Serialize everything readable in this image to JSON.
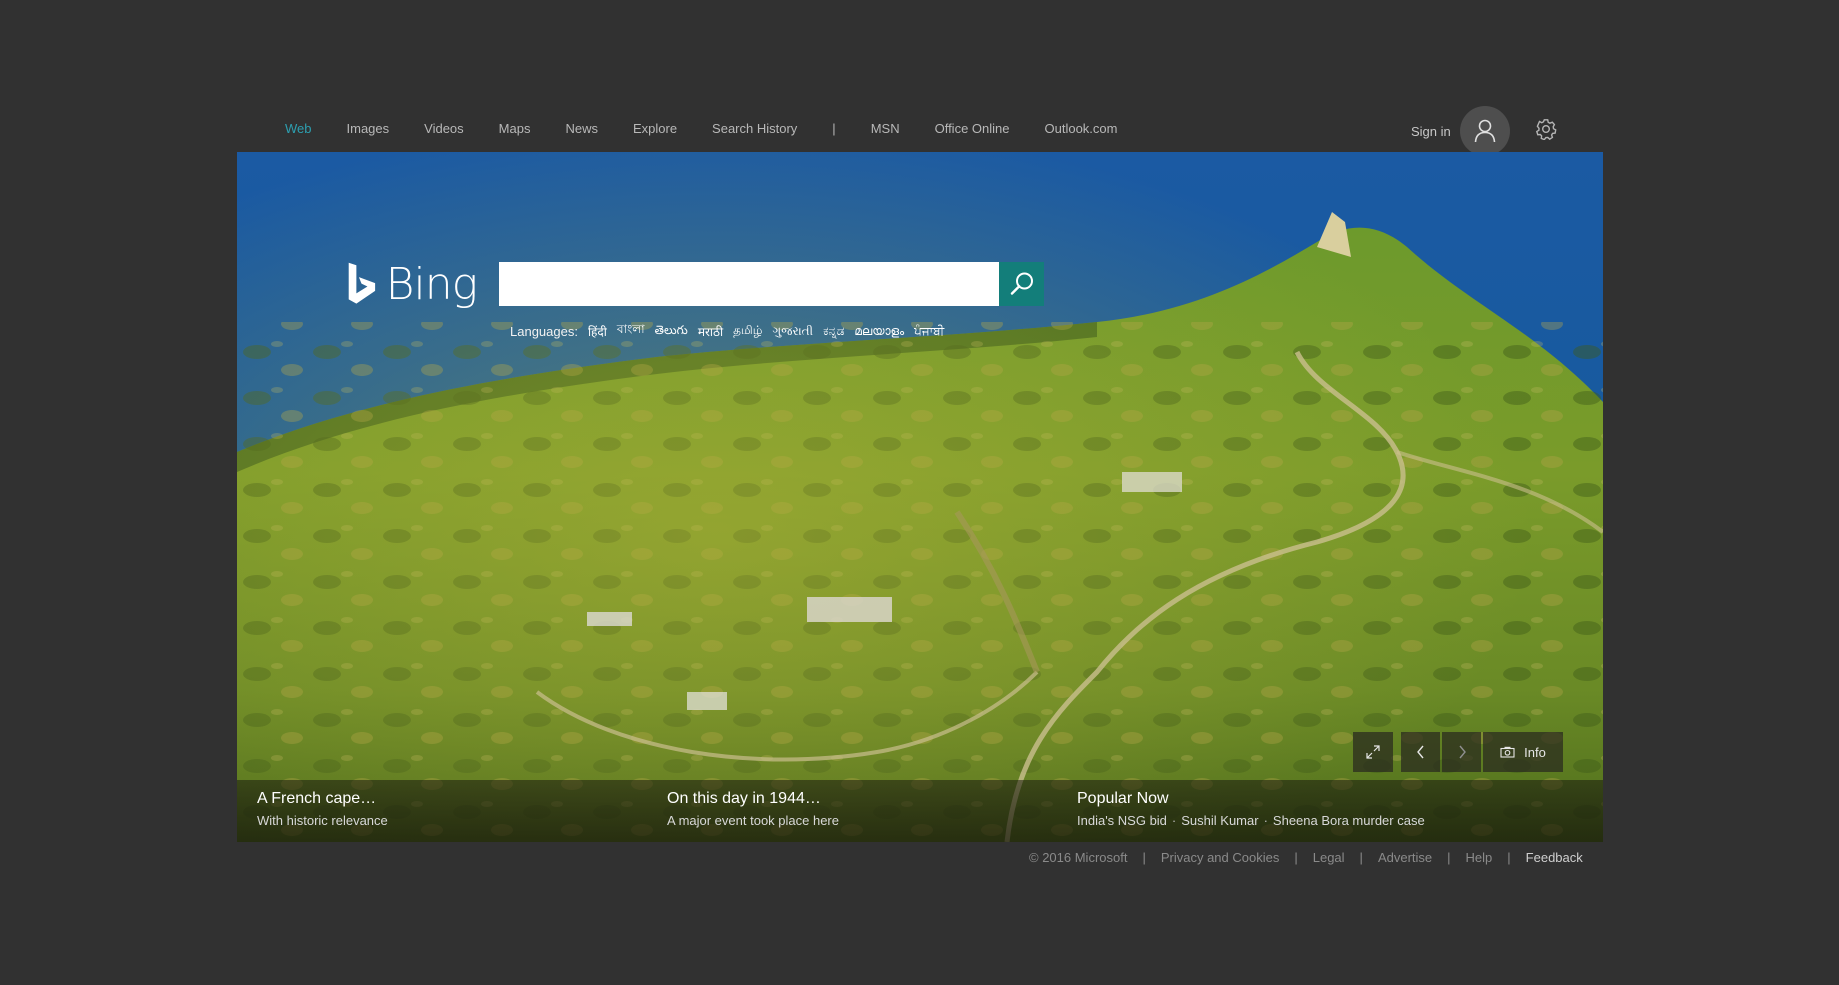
{
  "nav": {
    "items": [
      {
        "label": "Web",
        "active": true
      },
      {
        "label": "Images"
      },
      {
        "label": "Videos"
      },
      {
        "label": "Maps"
      },
      {
        "label": "News"
      },
      {
        "label": "Explore"
      },
      {
        "label": "Search History"
      }
    ],
    "separator": "|",
    "external": [
      {
        "label": "MSN"
      },
      {
        "label": "Office Online"
      },
      {
        "label": "Outlook.com"
      }
    ]
  },
  "account": {
    "sign_in_label": "Sign in"
  },
  "search": {
    "logo_text": "Bing",
    "value": "",
    "placeholder": ""
  },
  "languages": {
    "label": "Languages:",
    "items": [
      "हिंदी",
      "বাংলা",
      "తెలుగు",
      "मराठी",
      "தமிழ்",
      "ગુજરાતી",
      "ಕನ್ನಡ",
      "മലയാളം",
      "ਪੰਜਾਬੀ"
    ]
  },
  "image_controls": {
    "info_label": "Info"
  },
  "cards": [
    {
      "title": "A French cape…",
      "subtitle": "With historic relevance"
    },
    {
      "title": "On this day in 1944…",
      "subtitle": "A major event took place here"
    },
    {
      "title": "Popular Now",
      "links": [
        "India's NSG bid",
        "Sushil Kumar",
        "Sheena Bora murder case"
      ],
      "separator": "·"
    }
  ],
  "footer": {
    "copyright": "© 2016 Microsoft",
    "links": [
      "Privacy and Cookies",
      "Legal",
      "Advertise",
      "Help"
    ],
    "feedback": "Feedback",
    "separator": "|"
  },
  "colors": {
    "accent": "#137e7a",
    "active_nav": "#2d9fb0",
    "page_background": "#313131"
  }
}
